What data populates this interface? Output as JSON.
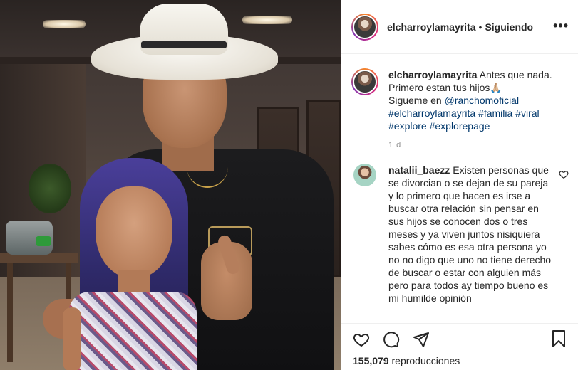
{
  "post": {
    "username": "elcharroylamayrita",
    "separator": "•",
    "follow_status": "Siguiendo",
    "more_icon": "more-horizontal-icon"
  },
  "caption": {
    "username": "elcharroylamayrita",
    "line1": "Antes que nada.",
    "line2": "Primero estan tus hijos",
    "emoji": "🙏🏼",
    "line3_prefix": "Sigueme en ",
    "mention": "@ranchomoficial",
    "hashtags_line1": "#elcharroylamayrita #familia #viral",
    "hashtags_line2": "#explore #explorepage",
    "time": "1 d"
  },
  "comment": {
    "username": "natalii_baezz",
    "text": "Existen personas que se divorcian o se dejan de su pareja y lo primero que hacen es irse a buscar otra relación sin pensar en sus hijos se conocen dos o tres meses y ya viven juntos nisiquiera sabes cómo es esa otra persona yo no no digo que uno no tiene derecho de buscar o estar con alguien más pero para todos ay tiempo bueno es mi humilde opinión"
  },
  "actions": {
    "views_count": "155,079",
    "views_label": "reproducciones",
    "icons": [
      "heart-icon",
      "comment-icon",
      "share-icon",
      "bookmark-icon"
    ]
  },
  "colors": {
    "text": "#262626",
    "link": "#00376b",
    "muted": "#8e8e8e",
    "border": "#efefef"
  }
}
